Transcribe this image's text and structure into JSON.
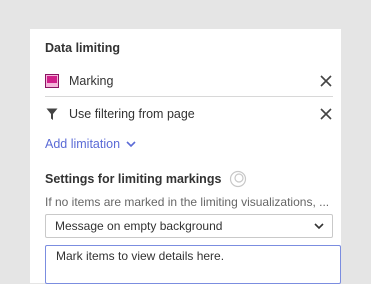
{
  "section": {
    "title": "Data limiting"
  },
  "limitations": [
    {
      "label": "Marking",
      "icon": "marking-swatch-icon",
      "color": "#d0208a"
    },
    {
      "label": "Use filtering from page",
      "icon": "filter-funnel-icon"
    }
  ],
  "add_limitation": {
    "label": "Add limitation"
  },
  "settings": {
    "title": "Settings for limiting markings",
    "hint": "If no items are marked in the limiting visualizations, ...",
    "select_value": "Message on empty background",
    "message_text": "Mark items to view details here."
  },
  "colors": {
    "accent": "#5b6bd6",
    "panel_background": "#ffffff",
    "page_background": "#e5e5e5",
    "marking": "#d0208a"
  }
}
